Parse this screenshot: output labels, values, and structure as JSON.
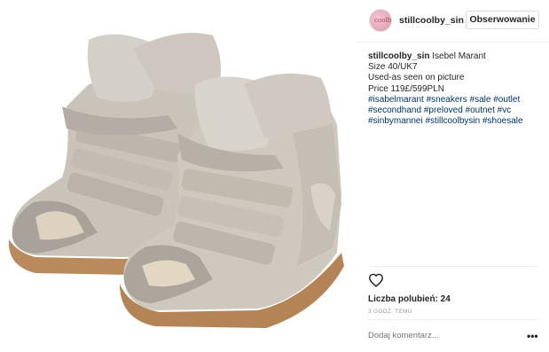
{
  "post": {
    "image_alt": "",
    "header": {
      "avatar_icon": "profile-avatar-icon",
      "avatar_text": "coolby",
      "username": "stillcoolby_sin",
      "follow_label": "Obserwowanie"
    },
    "caption": {
      "username": "stillcoolby_sin",
      "line1_text": "Isebel Marant",
      "line2": "Size 40/UK7",
      "line3": "Used-as seen on picture",
      "line4": "Price 119£/599PLN",
      "hashtags_line1": "#isabelmarant #sneakers #sale #outlet",
      "hashtags_line2": "#secondhand #preloved #outnet #vc",
      "hashtags_line3": "#sinbymannei #stillcoolbysin #shoesale"
    },
    "actions": {
      "like_icon": "heart-icon",
      "likes_text": "Liczba polubień: 24",
      "time_text": "3 GODZ. TEMU"
    },
    "comment": {
      "placeholder": "Dodaj komentarz...",
      "more_label": "•••",
      "more_icon": "more-options-icon"
    }
  }
}
